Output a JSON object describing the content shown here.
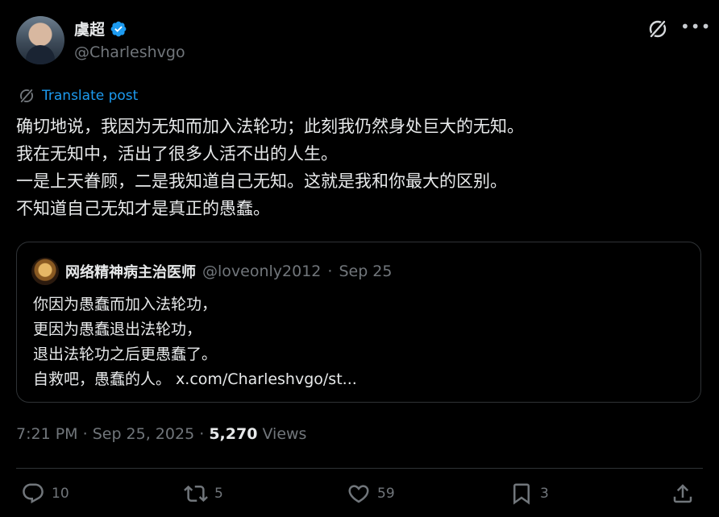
{
  "author": {
    "display_name": "虞超",
    "handle": "@Charleshvgo",
    "verified": true,
    "avatar_icon": "user-avatar"
  },
  "translate_label": "Translate post",
  "tweet_lines": [
    "确切地说，我因为无知而加入法轮功；此刻我仍然身处巨大的无知。",
    "我在无知中，活出了很多人活不出的人生。",
    "一是上天眷顾，二是我知道自己无知。这就是我和你最大的区别。",
    "不知道自己无知才是真正的愚蠢。"
  ],
  "quote": {
    "display_name": "网络精神病主治医师",
    "handle": "@loveonly2012",
    "separator": "·",
    "date": "Sep 25",
    "lines": [
      "你因为愚蠢而加入法轮功，",
      "更因为愚蠢退出法轮功，",
      "退出法轮功之后更愚蠢了。",
      "自救吧，愚蠢的人。 x.com/Charleshvgo/st..."
    ]
  },
  "meta": {
    "time": "7:21 PM",
    "sep1": "·",
    "date": "Sep 25, 2025",
    "sep2": "·",
    "views_count": "5,270",
    "views_label": "Views"
  },
  "actions": {
    "replies": "10",
    "reposts": "5",
    "likes": "59",
    "bookmarks": "3"
  },
  "colors": {
    "background": "#000000",
    "text": "#e7e9ea",
    "muted": "#71767b",
    "accent": "#1d9bf0",
    "border": "#2f3336"
  }
}
